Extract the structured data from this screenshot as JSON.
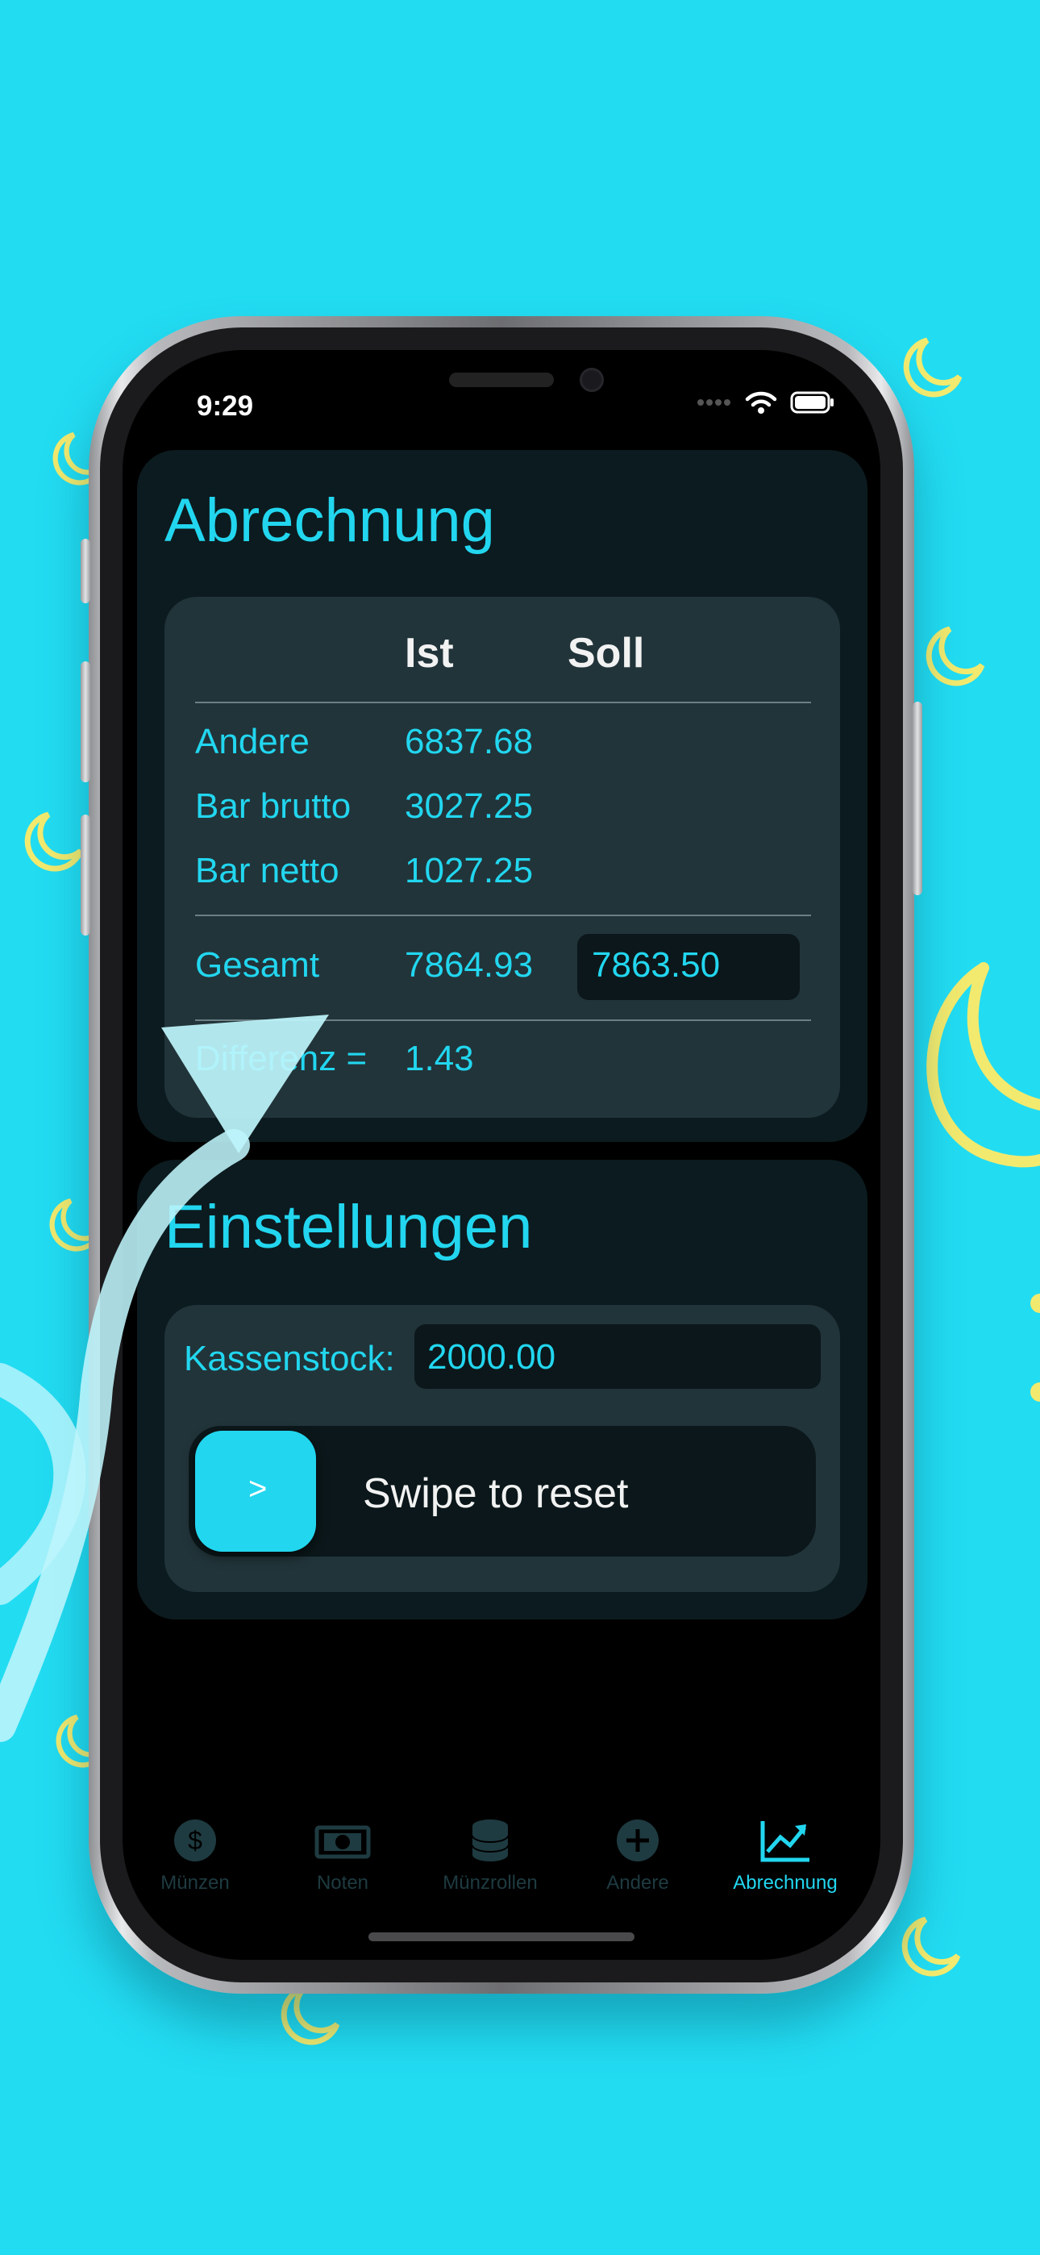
{
  "status_bar": {
    "time": "9:29"
  },
  "abrechnung": {
    "title": "Abrechnung",
    "col_ist": "Ist",
    "col_soll": "Soll",
    "rows": [
      {
        "label": "Andere",
        "ist": "6837.68"
      },
      {
        "label": "Bar brutto",
        "ist": "3027.25"
      },
      {
        "label": "Bar netto",
        "ist": "1027.25"
      }
    ],
    "gesamt_label": "Gesamt",
    "gesamt_ist": "7864.93",
    "soll_value": "7863.50",
    "differenz_label": "Differenz =",
    "differenz_value": "1.43"
  },
  "einstellungen": {
    "title": "Einstellungen",
    "kassenstock_label": "Kassenstock:",
    "kassenstock_value": "2000.00",
    "swipe_label": "Swipe to reset",
    "swipe_chevron": ">"
  },
  "tabs": [
    {
      "label": "Münzen",
      "icon": "dollar-coin-icon"
    },
    {
      "label": "Noten",
      "icon": "banknote-icon"
    },
    {
      "label": "Münzrollen",
      "icon": "coin-stack-icon"
    },
    {
      "label": "Andere",
      "icon": "plus-circle-icon"
    },
    {
      "label": "Abrechnung",
      "icon": "chart-trend-icon",
      "active": true
    }
  ],
  "colors": {
    "background": "#22dcf2",
    "accent": "#22d6ef",
    "moon": "#f2ea6e",
    "card": "#0c1b1f",
    "inner_card": "#213439"
  }
}
